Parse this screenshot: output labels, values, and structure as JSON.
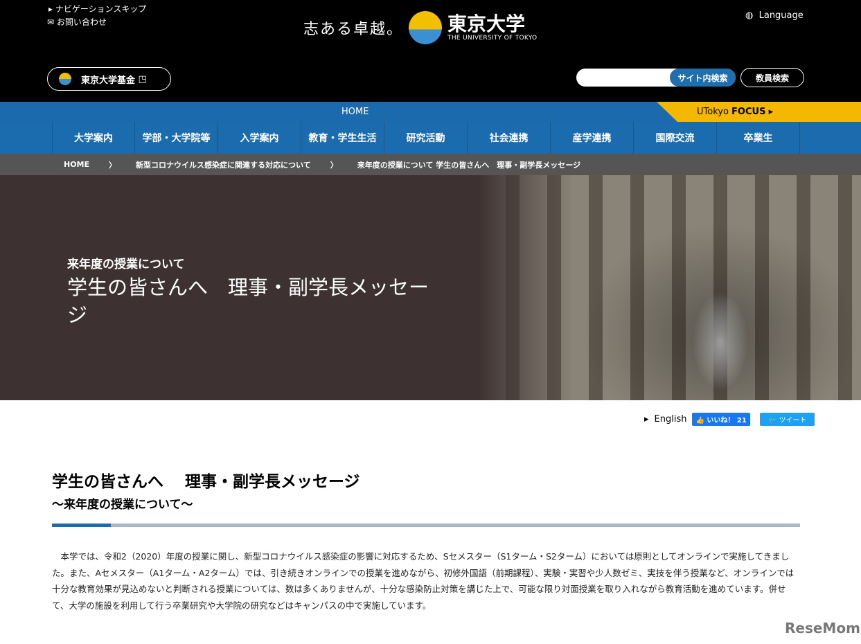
{
  "header": {
    "skip": "ナビゲーションスキップ",
    "contact": "お問い合わせ",
    "slogan": "志ある卓越。",
    "univ_jp": "東京大学",
    "univ_en": "THE UNIVERSITY OF TOKYO",
    "language": "Language",
    "fund": "東京大学基金",
    "search_placeholder": "",
    "site_search": "サイト内検索",
    "faculty_search": "教員検索"
  },
  "homebar": {
    "home": "HOME",
    "focus_prefix": "UTokyo ",
    "focus": "FOCUS"
  },
  "nav": [
    "大学案内",
    "学部・大学院等",
    "入学案内",
    "教育・学生生活",
    "研究活動",
    "社会連携",
    "産学連携",
    "国際交流",
    "卒業生"
  ],
  "breadcrumb": [
    "HOME",
    "新型コロナウイルス感染症に関連する対応について",
    "来年度の授業について 学生の皆さんへ　理事・副学長メッセージ"
  ],
  "hero": {
    "subtitle": "来年度の授業について",
    "title": "学生の皆さんへ　理事・副学長メッセージ"
  },
  "share": {
    "english": "English",
    "like": "いいね！",
    "like_count": "21",
    "tweet": "ツイート"
  },
  "article": {
    "title": "学生の皆さんへ　 理事・副学長メッセージ",
    "subtitle": "～来年度の授業について～",
    "body": "本学では、令和2（2020）年度の授業に関し、新型コロナウイルス感染症の影響に対応するため、Sセメスター（S1ターム・S2ターム）においては原則としてオンラインで実施してきました。また、Aセメスター（A1ターム・A2ターム）では、引き続きオンラインでの授業を進めながら、初修外国語（前期課程）、実験・実習や少人数ゼミ、実技を伴う授業など、オンラインでは十分な教育効果が見込めないと判断される授業については、数は多くありませんが、十分な感染防止対策を講じた上で、可能な限り対面授業を取り入れながら教育活動を進めています。併せて、大学の施設を利用して行う卒業研究や大学院の研究などはキャンパスの中で実施しています。"
  },
  "watermark": "ReseMom"
}
